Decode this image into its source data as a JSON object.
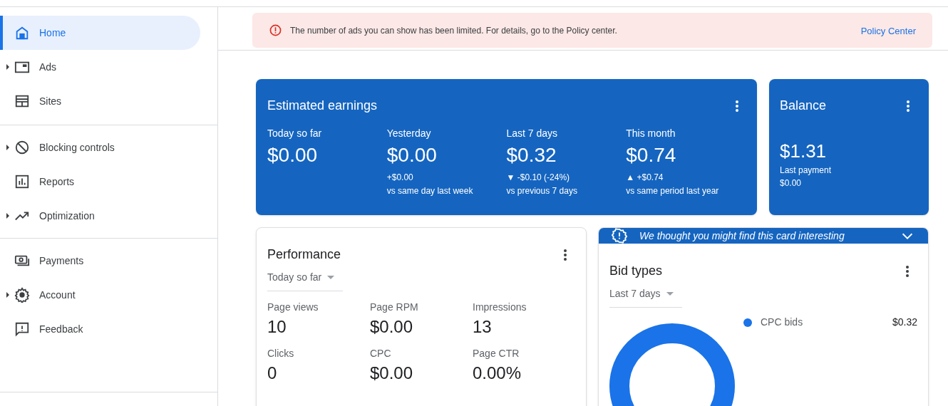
{
  "sidebar": {
    "groups": [
      {
        "items": [
          {
            "label": "Home",
            "selected": true,
            "expandable": false
          },
          {
            "label": "Ads",
            "selected": false,
            "expandable": true
          },
          {
            "label": "Sites",
            "selected": false,
            "expandable": false
          }
        ]
      },
      {
        "items": [
          {
            "label": "Blocking controls",
            "selected": false,
            "expandable": true
          },
          {
            "label": "Reports",
            "selected": false,
            "expandable": false
          },
          {
            "label": "Optimization",
            "selected": false,
            "expandable": true
          }
        ]
      },
      {
        "items": [
          {
            "label": "Payments",
            "selected": false,
            "expandable": false
          },
          {
            "label": "Account",
            "selected": false,
            "expandable": true
          },
          {
            "label": "Feedback",
            "selected": false,
            "expandable": false
          }
        ]
      }
    ]
  },
  "alert": {
    "message": "The number of ads you can show has been limited. For details, go to the Policy center.",
    "link": "Policy Center"
  },
  "earnings_card": {
    "title": "Estimated earnings",
    "metrics": [
      {
        "label": "Today so far",
        "value": "$0.00"
      },
      {
        "label": "Yesterday",
        "value": "$0.00",
        "change": "+$0.00",
        "comparison": "vs same day last week"
      },
      {
        "label": "Last 7 days",
        "value": "$0.32",
        "change": "▼ -$0.10 (-24%)",
        "comparison": "vs previous 7 days"
      },
      {
        "label": "This month",
        "value": "$0.74",
        "change": "▲ +$0.74",
        "comparison": "vs same period last year"
      }
    ]
  },
  "balance_card": {
    "title": "Balance",
    "value": "$1.31",
    "last_payment_label": "Last payment",
    "last_payment_value": "$0.00"
  },
  "performance_card": {
    "title": "Performance",
    "period": "Today so far",
    "metrics": [
      {
        "label": "Page views",
        "value": "10"
      },
      {
        "label": "Page RPM",
        "value": "$0.00"
      },
      {
        "label": "Impressions",
        "value": "13"
      },
      {
        "label": "Clicks",
        "value": "0"
      },
      {
        "label": "CPC",
        "value": "$0.00"
      },
      {
        "label": "Page CTR",
        "value": "0.00%"
      }
    ]
  },
  "suggestion_card": {
    "message": "We thought you might find this card interesting",
    "title": "Bid types",
    "period": "Last 7 days",
    "legend": [
      {
        "label": "CPC bids",
        "value": "$0.32",
        "color": "#1a73e8"
      }
    ]
  }
}
